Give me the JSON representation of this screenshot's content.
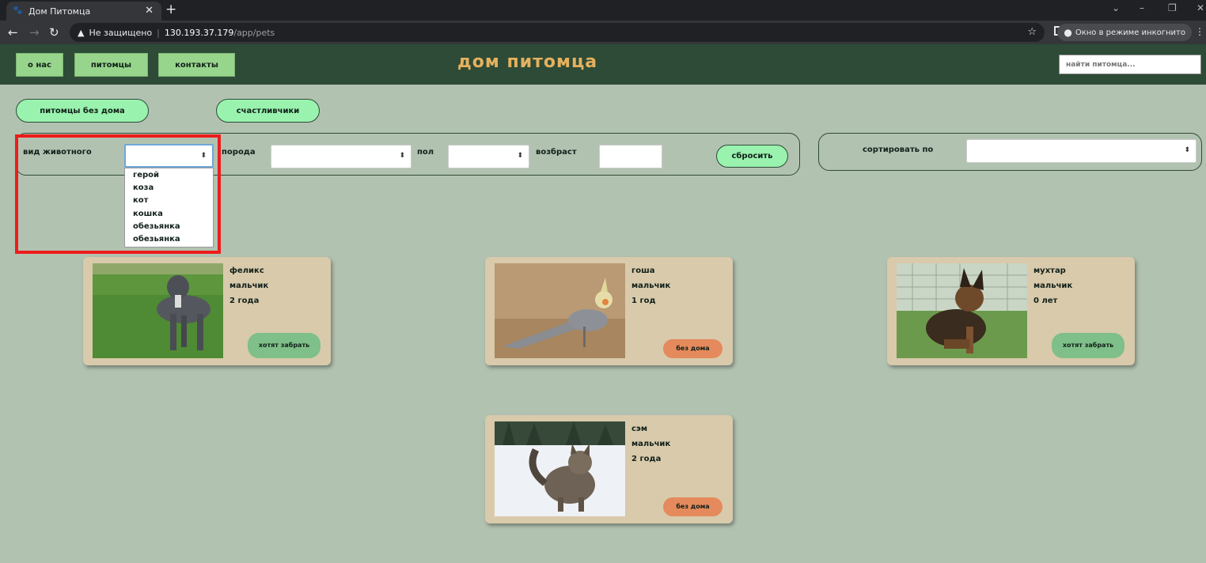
{
  "browser": {
    "tab_title": "Дом Питомца",
    "url_warning": "Не защищено",
    "url_host": "130.193.37.179",
    "url_path": "/app/pets",
    "incognito_label": "Окно в режиме инкогнито"
  },
  "header": {
    "nav": [
      "о нас",
      "питомцы",
      "контакты"
    ],
    "title": "дом питомца",
    "search_placeholder": "найти питомца..."
  },
  "tabs": {
    "homeless": "питомцы без дома",
    "lucky": "счастливчики"
  },
  "filters": {
    "species_label": "вид животного",
    "breed_label": "порода",
    "sex_label": "пол",
    "age_label": "возбраст",
    "reset_label": "сбросить",
    "species_options": [
      "герой",
      "коза",
      "кот",
      "кошка",
      "обезьянка",
      "обезьянка"
    ]
  },
  "sort": {
    "label": "сортировать по"
  },
  "pets": [
    {
      "name": "феликс",
      "sex": "мальчик",
      "age": "2 года",
      "status": "хотят забрать",
      "status_color": "#7fbf89"
    },
    {
      "name": "гоша",
      "sex": "мальчик",
      "age": "1 год",
      "status": "без дома",
      "status_color": "#e48a5c"
    },
    {
      "name": "мухтар",
      "sex": "мальчик",
      "age": "0 лет",
      "status": "хотят забрать",
      "status_color": "#7fbf89"
    },
    {
      "name": "сэм",
      "sex": "мальчик",
      "age": "2 года",
      "status": "без дома",
      "status_color": "#e48a5c"
    }
  ],
  "colors": {
    "header_bg": "#2d4b36",
    "page_bg": "#b2c2b1",
    "title": "#e5b15f",
    "nav_button": "#98d58c",
    "pill": "#99f2ae",
    "card_bg": "#d8caab",
    "highlight": "#ee1c1c"
  }
}
